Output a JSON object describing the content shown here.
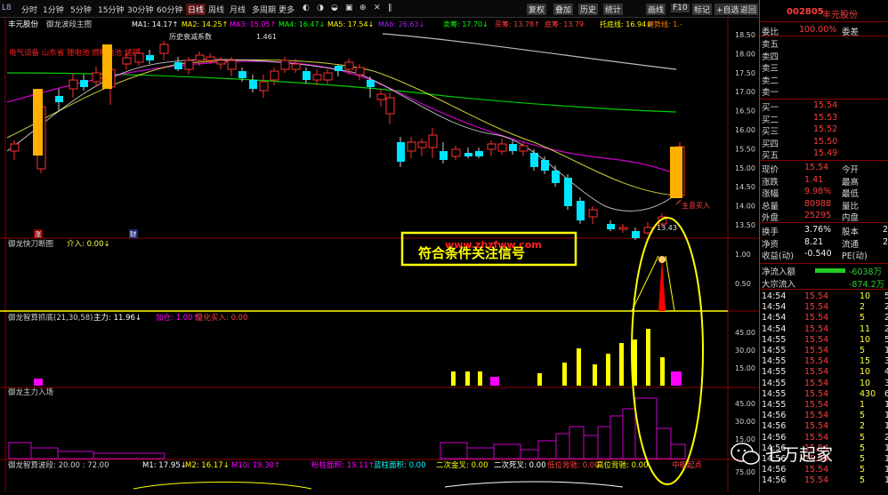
{
  "topbar": {
    "tabs": [
      "分时",
      "1分钟",
      "5分钟",
      "15分钟",
      "30分钟",
      "60分钟",
      "日线",
      "周线",
      "月线",
      "多周期",
      "更多"
    ],
    "active_tab": "日线",
    "icons": [
      "◐",
      "◑",
      "◒",
      "▣",
      "⊕",
      "✕",
      "‖"
    ],
    "nav": [
      "复权",
      "叠加",
      "历史",
      "统计",
      "画线",
      "F10",
      "标记",
      "+自选",
      "返回"
    ]
  },
  "main_panel": {
    "title": "丰元股份",
    "indicator": "御龙波段主图",
    "ma_labels": [
      {
        "text": "MA1: 14.17↑",
        "color": "#ffffff"
      },
      {
        "text": "MA2: 14.25↑",
        "color": "#ffff00"
      },
      {
        "text": "MA3: 15.05↑",
        "color": "#ff00ff"
      },
      {
        "text": "MA4: 16.47↓",
        "color": "#00ff00"
      },
      {
        "text": "MA5: 17.54↓",
        "color": "#ffff00"
      },
      {
        "text": "MA6: 26.63↓",
        "color": "#a020f0"
      },
      {
        "text": "卖筹: 17.70↓",
        "color": "#00ff00"
      },
      {
        "text": "买筹: 13.78↑",
        "color": "#ff4040"
      },
      {
        "text": "底筹: 13.79",
        "color": "#ff4040"
      },
      {
        "text": "托底线: 16.94↓",
        "color": "#ffff00"
      },
      {
        "text": "缠势线: 1.-",
        "color": "#ff8000"
      }
    ],
    "red_text": "电气设备 山东省 锂电池 燃料电池 储能",
    "history_label": "历史衰减系数",
    "history_value": "1.461",
    "price_axis": [
      "18.50",
      "18.00",
      "17.50",
      "17.00",
      "16.50",
      "16.00",
      "15.50",
      "15.00",
      "14.50",
      "14.00",
      "13.50"
    ],
    "annotation": "主意买入",
    "low_price": "13.43",
    "marker1": "涨",
    "marker2": "财"
  },
  "panel2": {
    "title": "御龙快刀断图",
    "label": "介入: 0.00↓",
    "axis": [
      "1.00",
      "0.50"
    ],
    "banner": "符合条件关注信号",
    "banner_url": "www.zhzfww.com"
  },
  "panel3": {
    "title": "御龙智算抓底(21,30,58)",
    "labels": [
      {
        "text": "主力: 11.96↓",
        "color": "#ffffff"
      },
      {
        "text": "加仓: 1.00↑",
        "color": "#ff00ff"
      },
      {
        "text": "量化买入: 0.00",
        "color": "#ff4040"
      }
    ],
    "axis": [
      "45.00",
      "30.00",
      "15.00"
    ]
  },
  "panel4": {
    "title": "御龙主力入场",
    "axis": [
      "45.00",
      "30.00",
      "15.00"
    ]
  },
  "bottom_bar": {
    "title": "御龙智算波段: 20.00 : 72.00",
    "items": [
      {
        "text": "M1: 17.95↓",
        "color": "#ffffff"
      },
      {
        "text": "M2: 16.17↓",
        "color": "#ffff00"
      },
      {
        "text": "M10: 19.30↑",
        "color": "#ff00ff"
      },
      {
        "text": "粉柱面积: 19.11↑",
        "color": "#ff00ff"
      },
      {
        "text": "蓝柱面积: 0.00",
        "color": "#00ffff"
      },
      {
        "text": "二次金叉: 0.00",
        "color": "#ffff00"
      },
      {
        "text": "二次死叉: 0.00",
        "color": "#ffffff"
      },
      {
        "text": "低位背驰: 0.00",
        "color": "#ff4040"
      },
      {
        "text": "高位背驰: 0.00",
        "color": "#ffff00"
      },
      {
        "text": "中枢起点",
        "color": "#ff4040"
      }
    ],
    "axis": [
      "75.00"
    ]
  },
  "right_panel": {
    "code": "002805",
    "name": "丰元股份",
    "weibi_label": "委比",
    "weibi_value": "100.00%",
    "weicha_label": "委差",
    "sells": [
      "卖五",
      "卖四",
      "卖三",
      "卖二",
      "卖一"
    ],
    "buys": [
      {
        "label": "买一",
        "price": "15.54"
      },
      {
        "label": "买二",
        "price": "15.53"
      },
      {
        "label": "买三",
        "price": "15.52"
      },
      {
        "label": "买四",
        "price": "15.50"
      },
      {
        "label": "买五",
        "price": "15.49"
      }
    ],
    "stats": [
      {
        "l1": "现价",
        "v1": "15.54",
        "l2": "今开"
      },
      {
        "l1": "涨跌",
        "v1": "1.41",
        "l2": "最高"
      },
      {
        "l1": "涨幅",
        "v1": "9.98%",
        "l2": "最低"
      },
      {
        "l1": "总量",
        "v1": "80988",
        "l2": "量比"
      },
      {
        "l1": "外盘",
        "v1": "25295",
        "l2": "内盘"
      }
    ],
    "stats2": [
      {
        "l1": "换手",
        "v1": "3.76%",
        "l2": "股本",
        "v2": "2"
      },
      {
        "l1": "净资",
        "v1": "8.21",
        "l2": "流通",
        "v2": "2"
      },
      {
        "l1": "收益(动)",
        "v1": "-0.540",
        "l2": "PE(动)",
        "v2": ""
      }
    ],
    "flows": [
      {
        "label": "净流入额",
        "value": "-6038万"
      },
      {
        "label": "大宗流入",
        "value": "-874.2万"
      }
    ],
    "ticks": [
      {
        "t": "14:54",
        "p": "15.54",
        "v": "10",
        "n": "5"
      },
      {
        "t": "14:54",
        "p": "15.54",
        "v": "2",
        "n": "2"
      },
      {
        "t": "14:54",
        "p": "15.54",
        "v": "5",
        "n": "2"
      },
      {
        "t": "14:54",
        "p": "15.54",
        "v": "11",
        "n": "2"
      },
      {
        "t": "14:55",
        "p": "15.54",
        "v": "10",
        "n": "5"
      },
      {
        "t": "14:55",
        "p": "15.54",
        "v": "5",
        "n": "1"
      },
      {
        "t": "14:55",
        "p": "15.54",
        "v": "15",
        "n": "3"
      },
      {
        "t": "14:55",
        "p": "15.54",
        "v": "10",
        "n": "4"
      },
      {
        "t": "14:55",
        "p": "15.54",
        "v": "10",
        "n": "3"
      },
      {
        "t": "14:55",
        "p": "15.54",
        "v": "430",
        "n": "6"
      },
      {
        "t": "14:55",
        "p": "15.54",
        "v": "1",
        "n": "1"
      },
      {
        "t": "14:56",
        "p": "15.54",
        "v": "5",
        "n": "1"
      },
      {
        "t": "14:56",
        "p": "15.54",
        "v": "2",
        "n": "1"
      },
      {
        "t": "14:56",
        "p": "15.54",
        "v": "5",
        "n": "2"
      },
      {
        "t": "14:56",
        "p": "15.54",
        "v": "5",
        "n": "1"
      },
      {
        "t": "14:56",
        "p": "15.54",
        "v": "5",
        "n": "1"
      },
      {
        "t": "14:56",
        "p": "15.54",
        "v": "5",
        "n": "1"
      },
      {
        "t": "14:56",
        "p": "15.54",
        "v": "5",
        "n": "1"
      }
    ]
  },
  "watermark": {
    "text": "七万起家"
  },
  "candles": [
    [
      12,
      150,
      142,
      160,
      138
    ],
    [
      42,
      170,
      100,
      175,
      95
    ],
    [
      62,
      88,
      95,
      105,
      80
    ],
    [
      78,
      80,
      70,
      90,
      62
    ],
    [
      90,
      70,
      78,
      82,
      64
    ],
    [
      104,
      72,
      62,
      78,
      55
    ],
    [
      120,
      78,
      58,
      98,
      54
    ],
    [
      138,
      52,
      45,
      58,
      40
    ],
    [
      152,
      50,
      40,
      54,
      34
    ],
    [
      164,
      42,
      48,
      52,
      36
    ],
    [
      180,
      40,
      30,
      48,
      26
    ],
    [
      196,
      50,
      58,
      60,
      44
    ],
    [
      208,
      58,
      48,
      64,
      44
    ],
    [
      220,
      48,
      42,
      54,
      38
    ],
    [
      232,
      48,
      44,
      52,
      40
    ],
    [
      244,
      52,
      48,
      58,
      44
    ],
    [
      256,
      58,
      48,
      66,
      44
    ],
    [
      268,
      60,
      68,
      72,
      56
    ],
    [
      280,
      70,
      80,
      84,
      64
    ],
    [
      292,
      82,
      72,
      90,
      64
    ],
    [
      304,
      70,
      60,
      76,
      56
    ],
    [
      316,
      58,
      48,
      62,
      44
    ],
    [
      328,
      58,
      52,
      62,
      46
    ],
    [
      340,
      60,
      70,
      74,
      56
    ],
    [
      352,
      70,
      64,
      76,
      58
    ],
    [
      364,
      70,
      62,
      74,
      58
    ],
    [
      376,
      54,
      60,
      66,
      52
    ],
    [
      388,
      58,
      50,
      64,
      46
    ],
    [
      400,
      64,
      56,
      70,
      52
    ],
    [
      412,
      70,
      78,
      90,
      66
    ],
    [
      424,
      92,
      86,
      100,
      80
    ],
    [
      434,
      108,
      90,
      120,
      84
    ],
    [
      446,
      140,
      162,
      168,
      134
    ],
    [
      458,
      150,
      140,
      158,
      134
    ],
    [
      470,
      146,
      140,
      156,
      136
    ],
    [
      482,
      146,
      132,
      158,
      124
    ],
    [
      494,
      150,
      160,
      164,
      140
    ],
    [
      508,
      156,
      148,
      160,
      144
    ],
    [
      522,
      152,
      156,
      158,
      146
    ],
    [
      534,
      150,
      156,
      158,
      146
    ],
    [
      548,
      148,
      142,
      156,
      138
    ],
    [
      560,
      150,
      142,
      154,
      136
    ],
    [
      572,
      142,
      150,
      154,
      138
    ],
    [
      584,
      150,
      144,
      156,
      140
    ],
    [
      596,
      152,
      168,
      172,
      148
    ],
    [
      608,
      160,
      172,
      176,
      156
    ],
    [
      620,
      172,
      186,
      190,
      166
    ],
    [
      634,
      180,
      212,
      216,
      176
    ],
    [
      648,
      206,
      228,
      232,
      202
    ],
    [
      662,
      224,
      216,
      232,
      212
    ],
    [
      682,
      232,
      238,
      240,
      228
    ],
    [
      696,
      238,
      236,
      242,
      232
    ],
    [
      710,
      240,
      248,
      250,
      236
    ],
    [
      724,
      242,
      236,
      244,
      230
    ],
    [
      740,
      232,
      224,
      236,
      220
    ],
    [
      760,
      200,
      145,
      202,
      140
    ]
  ]
}
